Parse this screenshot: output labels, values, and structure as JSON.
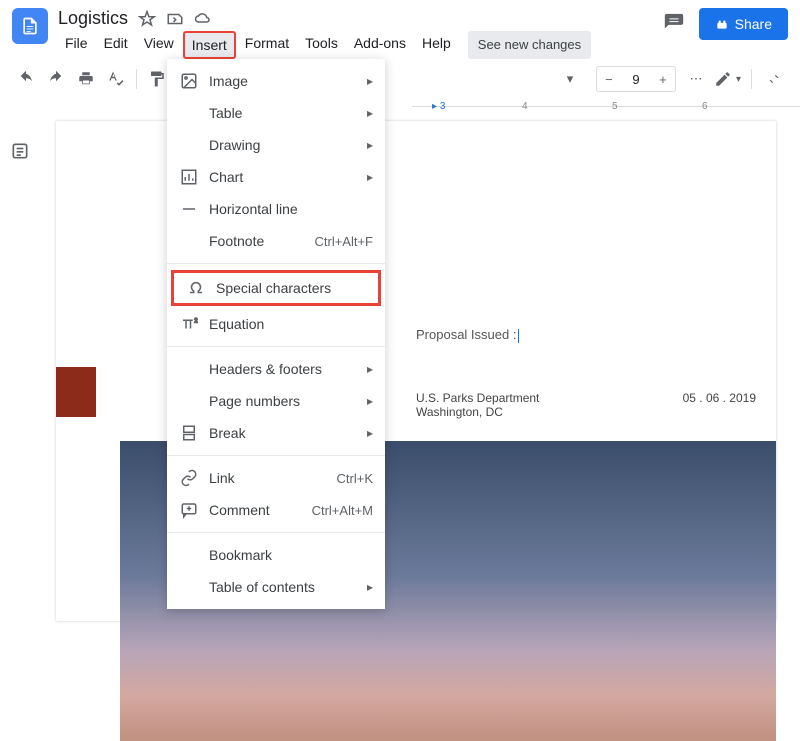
{
  "header": {
    "title": "Logistics",
    "see_changes": "See new changes",
    "share": "Share"
  },
  "menubar": {
    "file": "File",
    "edit": "Edit",
    "view": "View",
    "insert": "Insert",
    "format": "Format",
    "tools": "Tools",
    "addons": "Add-ons",
    "help": "Help"
  },
  "toolbar": {
    "zoom": "9"
  },
  "ruler": {
    "t3": "3",
    "t4": "4",
    "t5": "5",
    "t6": "6"
  },
  "document": {
    "proposal": "Proposal Issued :",
    "dept_line1": "U.S. Parks Department",
    "dept_line2": "Washington, DC",
    "date": "05 . 06 . 2019"
  },
  "insert_menu": {
    "image": "Image",
    "table": "Table",
    "drawing": "Drawing",
    "chart": "Chart",
    "horizontal_line": "Horizontal line",
    "footnote": "Footnote",
    "footnote_sc": "Ctrl+Alt+F",
    "special_chars": "Special characters",
    "equation": "Equation",
    "headers_footers": "Headers & footers",
    "page_numbers": "Page numbers",
    "break": "Break",
    "link": "Link",
    "link_sc": "Ctrl+K",
    "comment": "Comment",
    "comment_sc": "Ctrl+Alt+M",
    "bookmark": "Bookmark",
    "toc": "Table of contents"
  }
}
